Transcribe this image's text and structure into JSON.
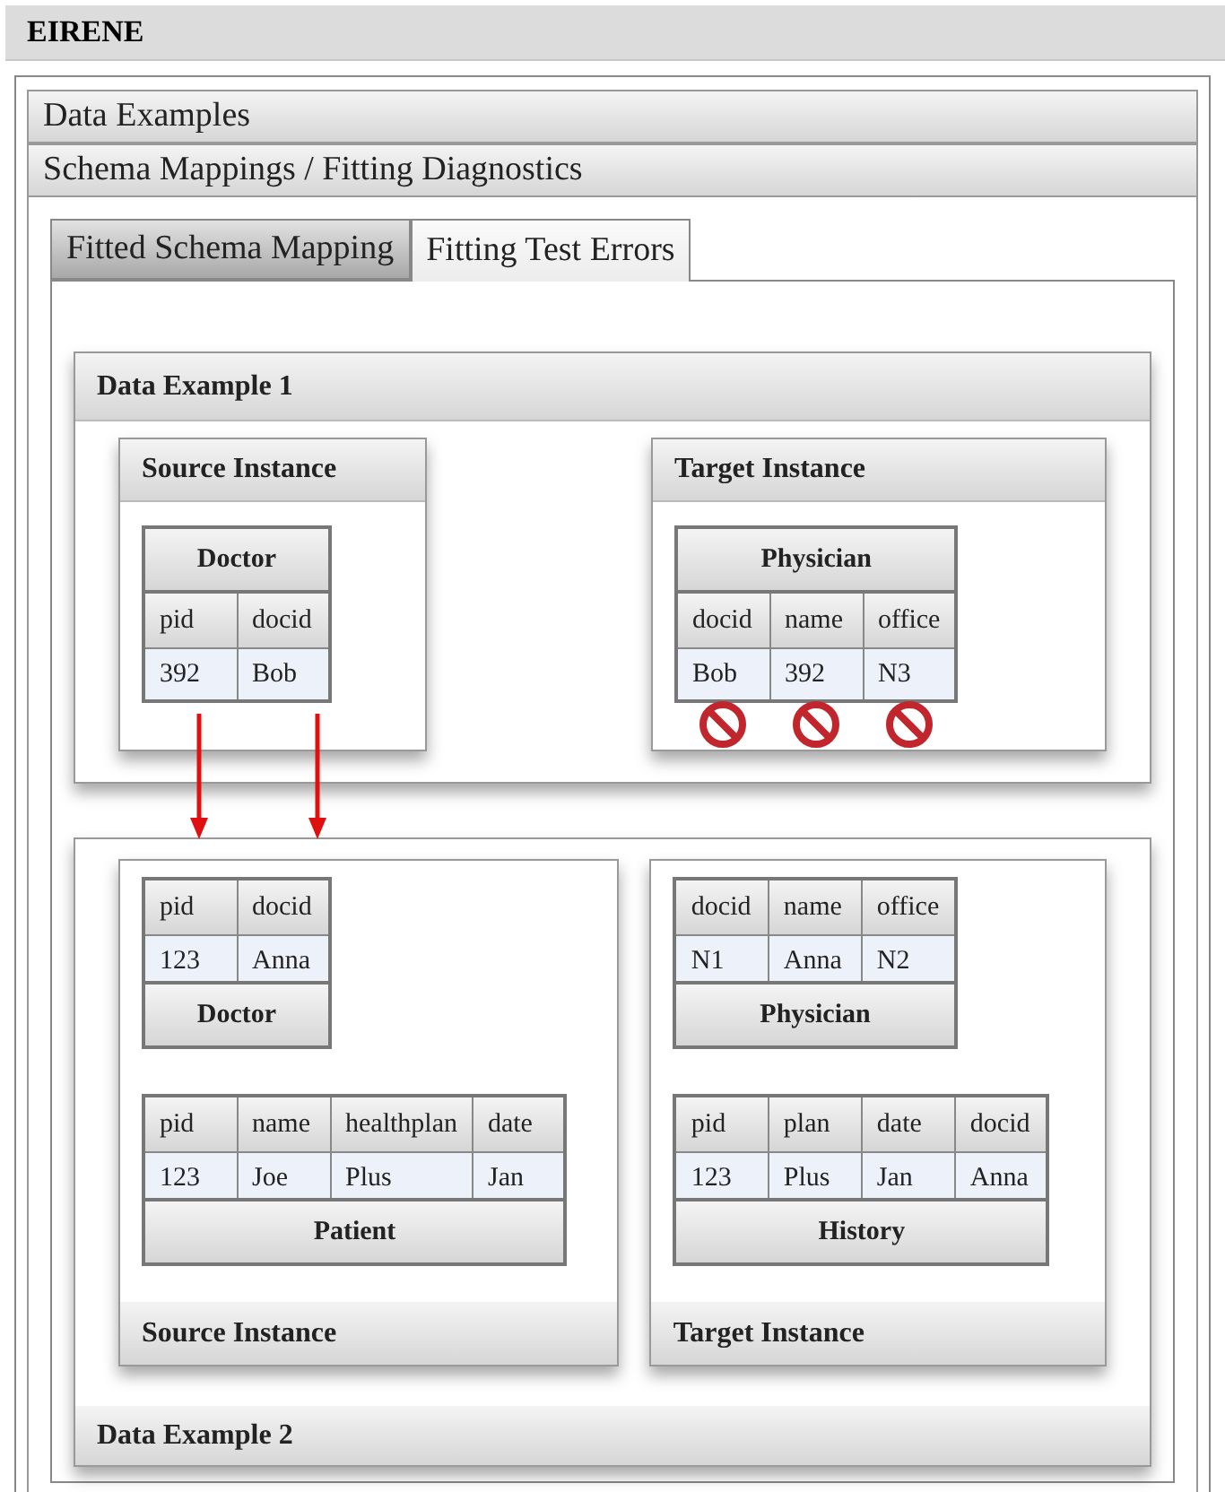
{
  "app_title": "EIRENE",
  "accordion": [
    {
      "label": "Data Examples"
    },
    {
      "label": "Schema Mappings / Fitting Diagnostics"
    }
  ],
  "tabs": [
    {
      "label": "Fitted Schema Mapping",
      "selected": false
    },
    {
      "label": "Fitting Test Errors",
      "selected": true
    }
  ],
  "examples": [
    {
      "title": "Data Example 1",
      "kind": "header",
      "instances": [
        {
          "title": "Source Instance",
          "tables": [
            {
              "title": "Doctor",
              "columns": [
                "pid",
                "docid"
              ],
              "rows": [
                [
                  "392",
                  "Bob"
                ]
              ]
            }
          ]
        },
        {
          "title": "Target Instance",
          "tables": [
            {
              "title": "Physician",
              "columns": [
                "docid",
                "name",
                "office"
              ],
              "rows": [
                [
                  "Bob",
                  "392",
                  "N3"
                ]
              ],
              "column_errors": [
                true,
                true,
                true
              ]
            }
          ]
        }
      ]
    },
    {
      "title": "Data Example 2",
      "kind": "footer",
      "instances": [
        {
          "title": "Source Instance",
          "tables": [
            {
              "title": "Doctor",
              "columns": [
                "pid",
                "docid"
              ],
              "rows": [
                [
                  "123",
                  "Anna"
                ]
              ]
            },
            {
              "title": "Patient",
              "columns": [
                "pid",
                "name",
                "healthplan",
                "date"
              ],
              "rows": [
                [
                  "123",
                  "Joe",
                  "Plus",
                  "Jan"
                ]
              ]
            }
          ]
        },
        {
          "title": "Target Instance",
          "tables": [
            {
              "title": "Physician",
              "columns": [
                "docid",
                "name",
                "office"
              ],
              "rows": [
                [
                  "N1",
                  "Anna",
                  "N2"
                ]
              ]
            },
            {
              "title": "History",
              "columns": [
                "pid",
                "plan",
                "date",
                "docid"
              ],
              "rows": [
                [
                  "123",
                  "Plus",
                  "Jan",
                  "Anna"
                ]
              ]
            }
          ]
        }
      ]
    }
  ]
}
